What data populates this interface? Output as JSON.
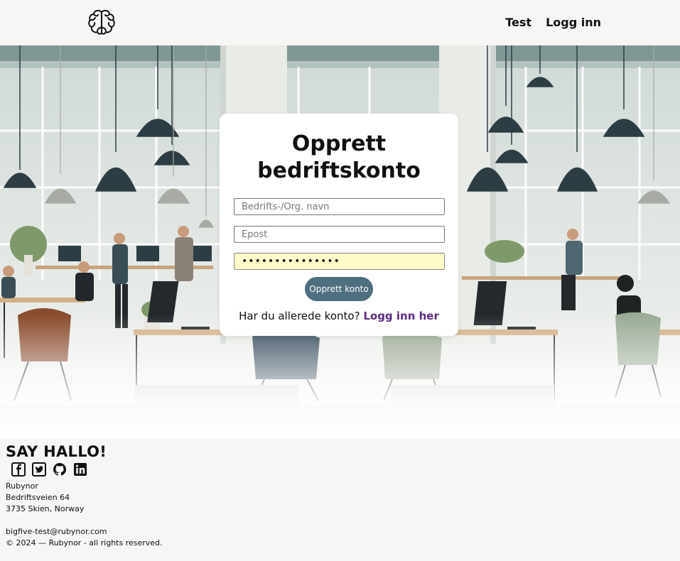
{
  "header": {
    "logo_icon": "brain-icon",
    "nav": [
      {
        "label": "Test"
      },
      {
        "label": "Logg inn"
      }
    ]
  },
  "form": {
    "title_line1": "Opprett",
    "title_line2": "bedriftskonto",
    "company_placeholder": "Bedrifts-/Org. navn",
    "email_placeholder": "Epost",
    "password_value": "•••••••••••••••",
    "submit_label": "Opprett konto",
    "login_prompt": "Har du allerede konto?",
    "login_link": "Logg inn her"
  },
  "footer": {
    "heading": "SAY HALLO!",
    "socials": [
      "facebook-icon",
      "twitter-icon",
      "github-icon",
      "linkedin-icon"
    ],
    "company": "Rubynor",
    "street": "Bedriftsveien 64",
    "city": "3735 Skien, Norway",
    "email": "bigfive-test@rubynor.com",
    "copyright": "© 2024 — Rubynor - all rights reserved."
  }
}
